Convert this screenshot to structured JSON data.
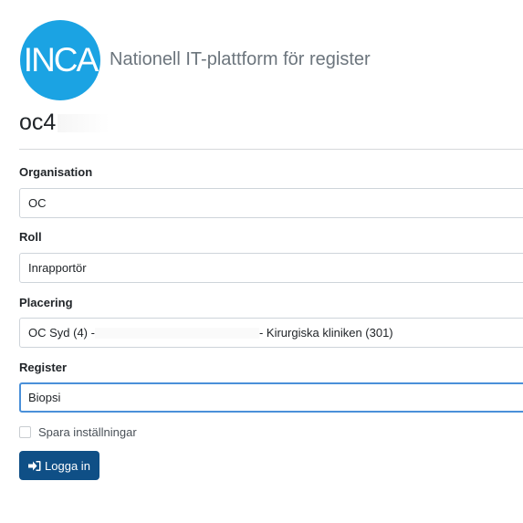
{
  "header": {
    "logo_text": "INCA",
    "app_title": "Nationell IT-plattform för register"
  },
  "user": {
    "username": "oc4"
  },
  "form": {
    "organisation": {
      "label": "Organisation",
      "value": "OC"
    },
    "role": {
      "label": "Roll",
      "value": "Inrapportör"
    },
    "placement": {
      "label": "Placering",
      "value_prefix": "OC Syd (4) -",
      "value_suffix": "- Kirurgiska kliniken (301)"
    },
    "register": {
      "label": "Register",
      "value": "Biopsi"
    },
    "save_settings_label": "Spara inställningar",
    "login_button_label": "Logga in"
  },
  "colors": {
    "logo": "#1ba3e3",
    "primary_button": "#0f4f86",
    "focus_border": "#4a90d9"
  },
  "icons": {
    "login": "sign-in-icon"
  }
}
